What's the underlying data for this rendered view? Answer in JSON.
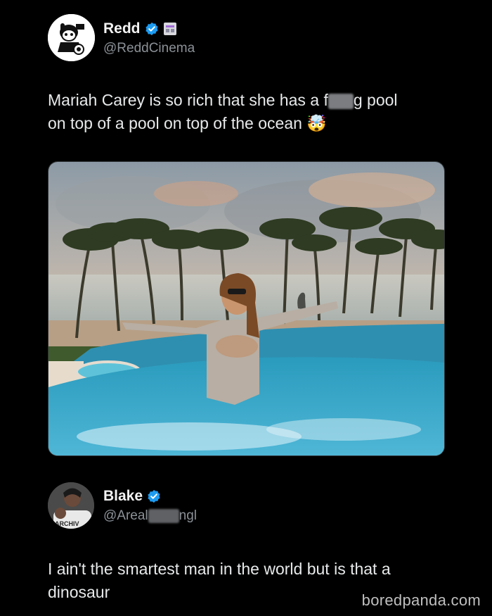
{
  "tweet": {
    "author_name": "Redd",
    "author_handle": "@ReddCinema",
    "text_line1_a": "Mariah Carey is so rich that she has a f",
    "text_line1_b": "g pool",
    "text_line2": "on top of a pool on top of the ocean",
    "emoji": "🤯"
  },
  "reply": {
    "author_name": "Blake",
    "author_handle_a": "@Areal",
    "author_handle_b": "ngl",
    "avatar_shirt_text": "ARCHIV",
    "text_line1": "I ain't the smartest man in the world but is that a",
    "text_line2": "dinosaur"
  },
  "watermark": "boredpanda.com",
  "colors": {
    "background": "#000000",
    "verified": "#1d9bf0",
    "handle": "#8b9197"
  }
}
